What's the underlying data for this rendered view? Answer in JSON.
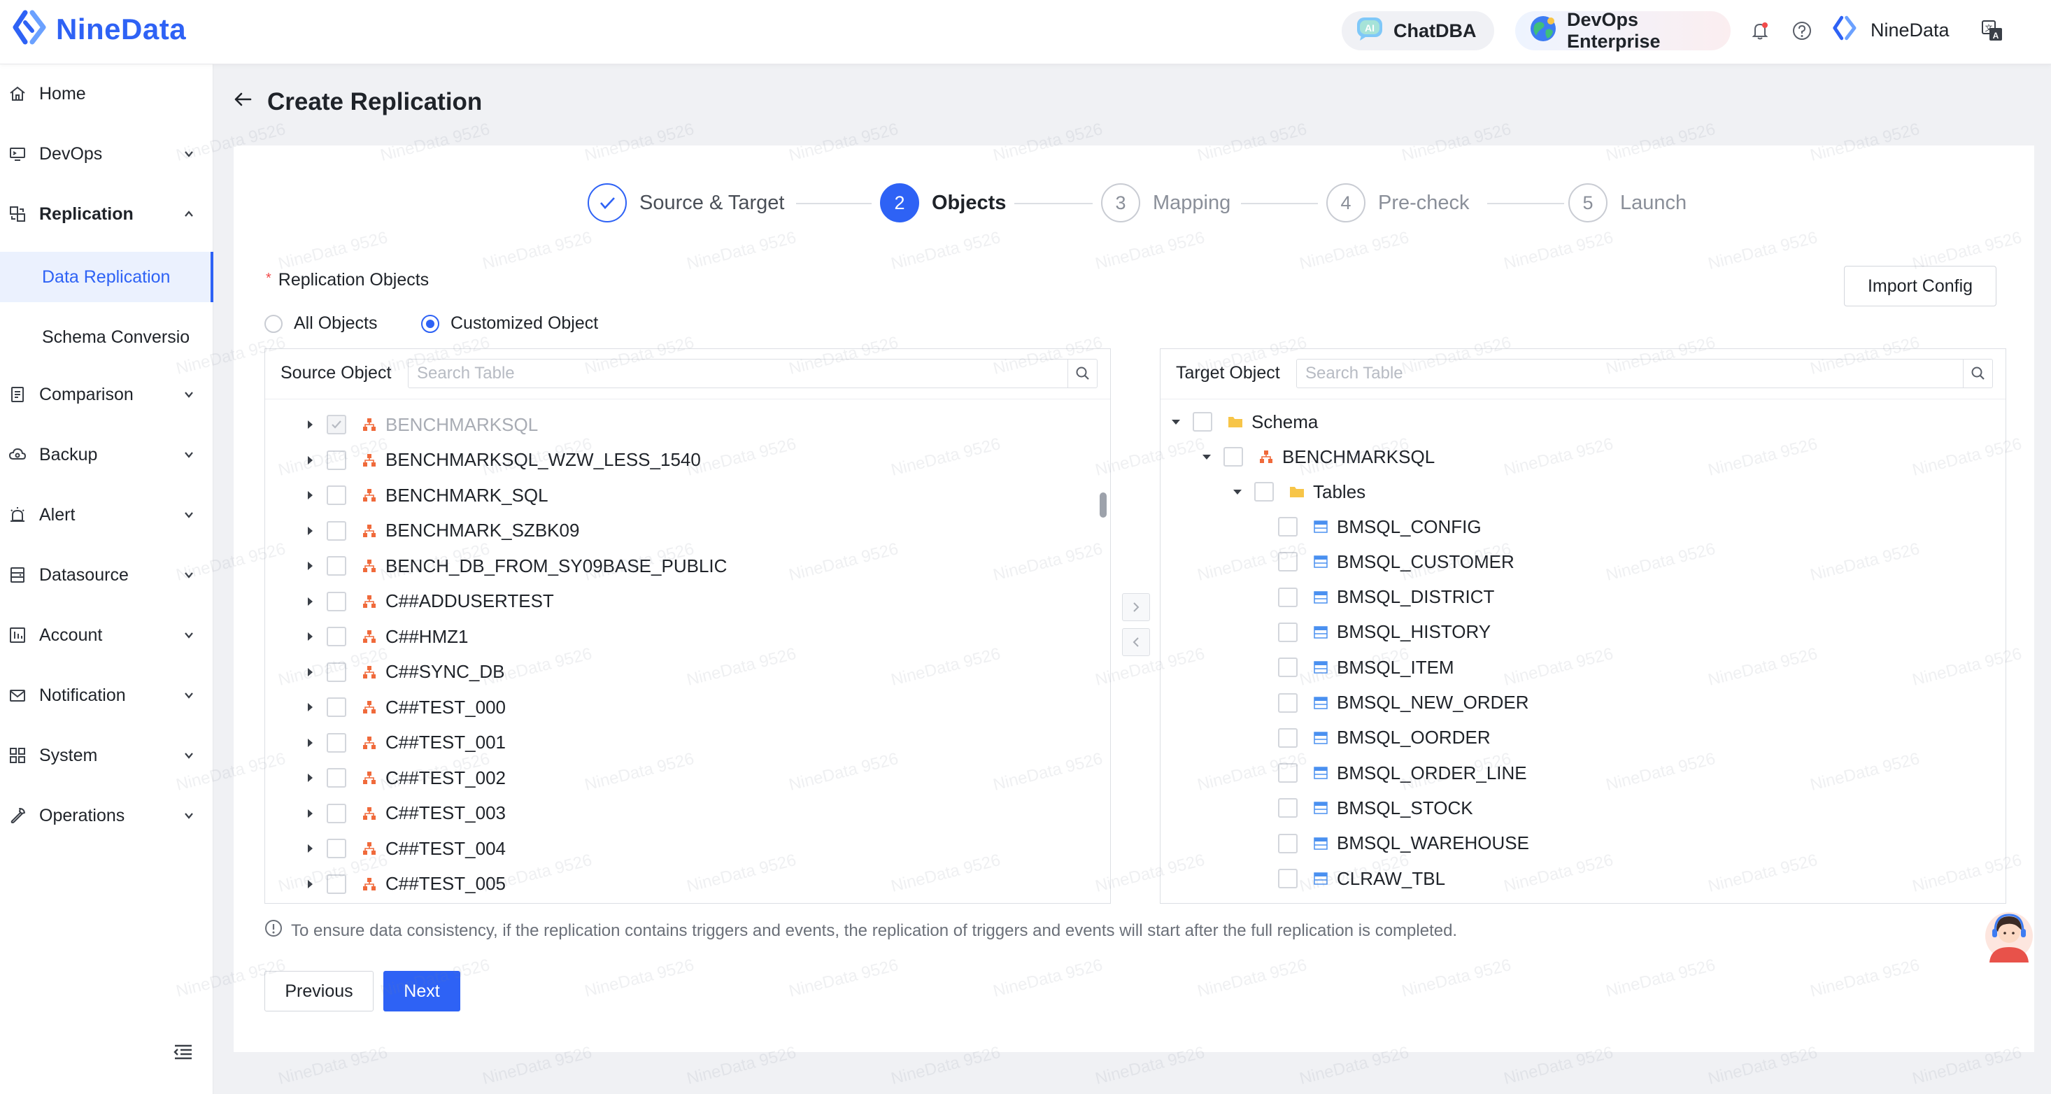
{
  "app": {
    "name": "NineData"
  },
  "header": {
    "chatdba_label": "ChatDBA",
    "devops_label": "DevOps Enterprise",
    "user_name": "NineData"
  },
  "sidebar": {
    "items": [
      {
        "label": "Home",
        "icon": "home-icon"
      },
      {
        "label": "DevOps",
        "icon": "devops-icon"
      },
      {
        "label": "Replication",
        "icon": "replication-icon"
      },
      {
        "label": "Comparison",
        "icon": "comparison-icon"
      },
      {
        "label": "Backup",
        "icon": "backup-icon"
      },
      {
        "label": "Alert",
        "icon": "alert-icon"
      },
      {
        "label": "Datasource",
        "icon": "datasource-icon"
      },
      {
        "label": "Account",
        "icon": "account-icon"
      },
      {
        "label": "Notification",
        "icon": "notification-icon"
      },
      {
        "label": "System",
        "icon": "system-icon"
      },
      {
        "label": "Operations",
        "icon": "operations-icon"
      }
    ],
    "subitems": [
      {
        "label": "Data Replication"
      },
      {
        "label": "Schema Conversio"
      }
    ]
  },
  "page": {
    "title": "Create Replication"
  },
  "steps": [
    {
      "number": "",
      "label": "Source & Target",
      "state": "done"
    },
    {
      "number": "2",
      "label": "Objects",
      "state": "active"
    },
    {
      "number": "3",
      "label": "Mapping",
      "state": "pending"
    },
    {
      "number": "4",
      "label": "Pre-check",
      "state": "pending"
    },
    {
      "number": "5",
      "label": "Launch",
      "state": "pending"
    }
  ],
  "form": {
    "required_label": "Replication Objects",
    "import_button": "Import Config",
    "radio_all": "All Objects",
    "radio_custom": "Customized Object",
    "selected_option": "Customized Object"
  },
  "source": {
    "title": "Source Object",
    "search_placeholder": "Search Table",
    "items": [
      "BENCHMARKSQL",
      "BENCHMARKSQL_WZW_LESS_1540",
      "BENCHMARK_SQL",
      "BENCHMARK_SZBK09",
      "BENCH_DB_FROM_SY09BASE_PUBLIC",
      "C##ADDUSERTEST",
      "C##HMZ1",
      "C##SYNC_DB",
      "C##TEST_000",
      "C##TEST_001",
      "C##TEST_002",
      "C##TEST_003",
      "C##TEST_004",
      "C##TEST_005"
    ]
  },
  "target": {
    "title": "Target Object",
    "search_placeholder": "Search Table",
    "schema_label": "Schema",
    "db_label": "BENCHMARKSQL",
    "tables_label": "Tables",
    "tables": [
      "BMSQL_CONFIG",
      "BMSQL_CUSTOMER",
      "BMSQL_DISTRICT",
      "BMSQL_HISTORY",
      "BMSQL_ITEM",
      "BMSQL_NEW_ORDER",
      "BMSQL_OORDER",
      "BMSQL_ORDER_LINE",
      "BMSQL_STOCK",
      "BMSQL_WAREHOUSE",
      "CLRAW_TBL"
    ]
  },
  "notice": "To ensure data consistency, if the replication contains triggers and events, the replication of triggers and events will start after the full replication is completed.",
  "footer": {
    "previous": "Previous",
    "next": "Next"
  },
  "watermark": "NineData 9526",
  "colors": {
    "primary": "#2e62f5",
    "db_icon": "#f06a3b",
    "folder_icon": "#f7c548",
    "table_icon": "#4a90f0"
  }
}
